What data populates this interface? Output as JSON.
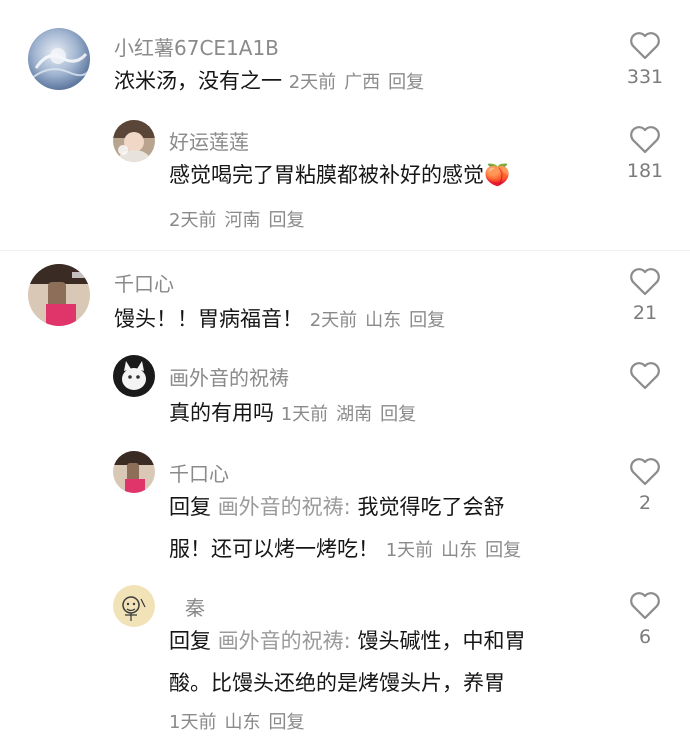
{
  "comments": [
    {
      "username": "小红薯67CE1A1B",
      "text": "浓米汤，没有之一",
      "time": "2天前",
      "location": "广西",
      "reply_label": "回复",
      "likes": "331"
    },
    {
      "username": "好运莲莲",
      "text": "感觉喝完了胃粘膜都被补好的感觉",
      "emoji": "🍑",
      "time": "2天前",
      "location": "河南",
      "reply_label": "回复",
      "likes": "181"
    },
    {
      "username": "千口心",
      "text": "馒头！！胃病福音！",
      "time": "2天前",
      "location": "山东",
      "reply_label": "回复",
      "likes": "21"
    },
    {
      "username": "画外音的祝祷",
      "text": "真的有用吗",
      "time": "1天前",
      "location": "湖南",
      "reply_label": "回复",
      "likes": ""
    },
    {
      "username": "千口心",
      "reply_prefix": "回复",
      "mention": "画外音的祝祷:",
      "text_line1": " 我觉得吃了会舒",
      "text_line2": "服！还可以烤一烤吃！",
      "time": "1天前",
      "location": "山东",
      "reply_label": "回复",
      "likes": "2"
    },
    {
      "username": "秦",
      "reply_prefix": "回复",
      "mention": "画外音的祝祷:",
      "text_line1": " 馒头碱性，中和胃",
      "text_line2": "酸。比馒头还绝的是烤馒头片，养胃",
      "time": "1天前",
      "location": "山东",
      "reply_label": "回复",
      "likes": "6"
    }
  ],
  "icons": {
    "like": "heart-outline-icon"
  },
  "colors": {
    "text": "#161616",
    "meta": "#8a8a8a",
    "heart_stroke": "#8c8c8c"
  }
}
